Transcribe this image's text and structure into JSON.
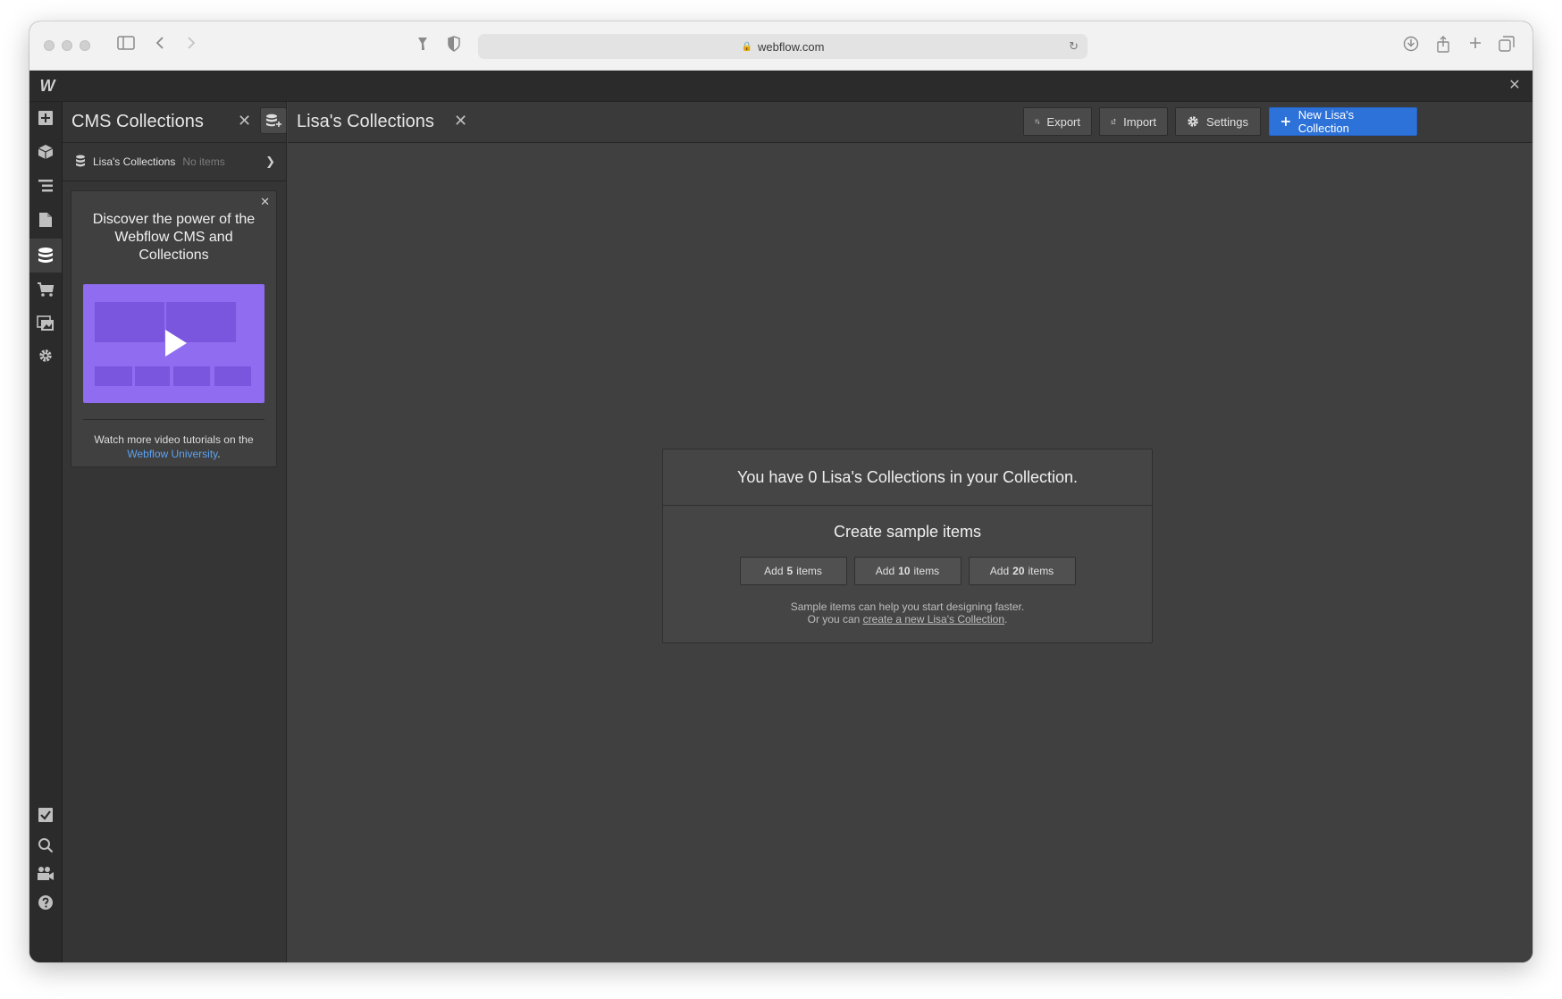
{
  "browser": {
    "url": "webflow.com"
  },
  "cms_panel": {
    "title": "CMS Collections",
    "collection": {
      "name": "Lisa's Collections",
      "count": "No items"
    },
    "promo": {
      "title": "Discover the power of the Webflow CMS and Collections",
      "footer_text": "Watch more video tutorials on the",
      "footer_link": "Webflow University",
      "footer_end": "."
    }
  },
  "main": {
    "title": "Lisa's Collections",
    "buttons": {
      "export": "Export",
      "import": "Import",
      "settings": "Settings",
      "new": "New Lisa's Collection"
    },
    "empty_state": {
      "message": "You have 0 Lisa's Collections in your Collection.",
      "subtitle": "Create sample items",
      "add_prefix": "Add",
      "add_suffix": "items",
      "counts": [
        "5",
        "10",
        "20"
      ],
      "note_line1": "Sample items can help you start designing faster.",
      "note_line2_prefix": "Or you can",
      "note_line2_link": "create a new Lisa's Collection",
      "note_line2_suffix": "."
    }
  },
  "colors": {
    "accent": "#2d72d9",
    "link": "#5aa3f5",
    "video": "#8f6cf0"
  }
}
